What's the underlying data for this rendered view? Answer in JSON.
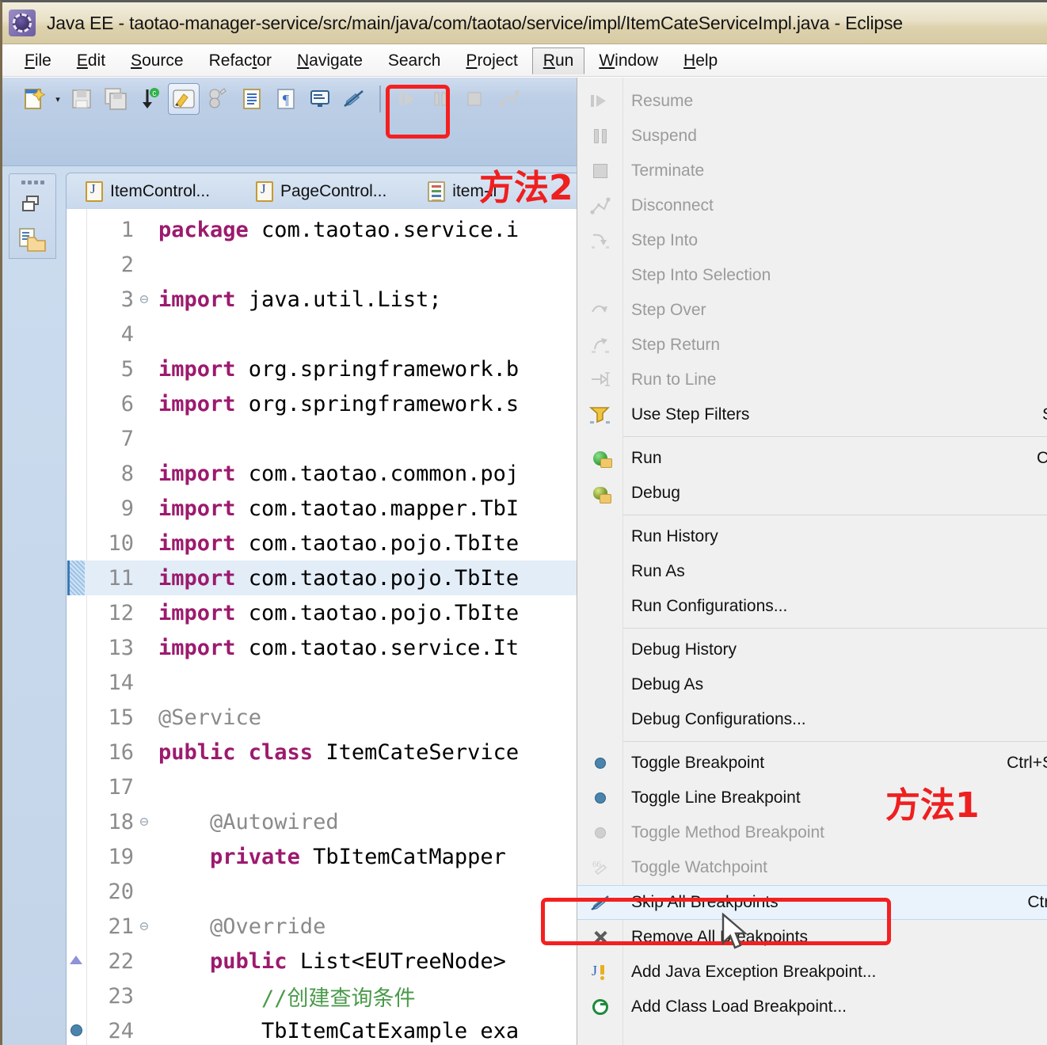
{
  "window": {
    "title": "Java EE - taotao-manager-service/src/main/java/com/taotao/service/impl/ItemCateServiceImpl.java - Eclipse",
    "app_icon": "eclipse-icon"
  },
  "menubar": {
    "items": [
      {
        "label": "File",
        "mnemonic": "F",
        "active": false
      },
      {
        "label": "Edit",
        "mnemonic": "E",
        "active": false
      },
      {
        "label": "Source",
        "mnemonic": "S",
        "active": false
      },
      {
        "label": "Refactor",
        "mnemonic": "t",
        "active": false
      },
      {
        "label": "Navigate",
        "mnemonic": "N",
        "active": false
      },
      {
        "label": "Search",
        "mnemonic": "",
        "active": false
      },
      {
        "label": "Project",
        "mnemonic": "P",
        "active": false
      },
      {
        "label": "Run",
        "mnemonic": "R",
        "active": true
      },
      {
        "label": "Window",
        "mnemonic": "W",
        "active": false
      },
      {
        "label": "Help",
        "mnemonic": "H",
        "active": false
      }
    ]
  },
  "toolbar": {
    "buttons": [
      {
        "name": "new-wizard-icon",
        "pressed": false
      },
      {
        "name": "new-wizard-dropdown-icon",
        "pressed": false
      },
      {
        "name": "save-icon",
        "pressed": false
      },
      {
        "name": "save-all-icon",
        "pressed": false
      },
      {
        "name": "print-icon",
        "pressed": false
      },
      {
        "name": "quick-access-icon",
        "pressed": false
      },
      {
        "name": "toggle-markoccurrences-icon",
        "pressed": true
      },
      {
        "name": "build-icon",
        "pressed": false
      },
      {
        "name": "open-type-icon",
        "pressed": false
      },
      {
        "name": "show-whitespace-icon",
        "pressed": false
      },
      {
        "name": "open-console-icon",
        "pressed": false
      },
      {
        "name": "skip-all-breakpoints-icon",
        "pressed": false
      },
      {
        "name": "resume-icon",
        "pressed": false
      },
      {
        "name": "suspend-icon",
        "pressed": false
      },
      {
        "name": "terminate-icon",
        "pressed": false
      },
      {
        "name": "disconnect-icon",
        "pressed": false
      }
    ]
  },
  "editor": {
    "tabs": [
      {
        "label": "ItemControl...",
        "icon": "java-file-icon",
        "active": false
      },
      {
        "label": "PageControl...",
        "icon": "java-file-icon",
        "active": false
      },
      {
        "label": "item-li",
        "icon": "xml-file-icon",
        "active": false
      }
    ],
    "lines": [
      {
        "num": "1",
        "fold": "",
        "marker": "",
        "highlight": false,
        "segments": [
          {
            "t": "package",
            "c": "kw"
          },
          {
            "t": " com.taotao.service.i",
            "c": ""
          }
        ]
      },
      {
        "num": "2",
        "fold": "",
        "marker": "",
        "highlight": false,
        "segments": []
      },
      {
        "num": "3",
        "fold": "⊖",
        "marker": "",
        "highlight": false,
        "segments": [
          {
            "t": "import",
            "c": "kw"
          },
          {
            "t": " java.util.List;",
            "c": ""
          }
        ]
      },
      {
        "num": "4",
        "fold": "",
        "marker": "",
        "highlight": false,
        "segments": []
      },
      {
        "num": "5",
        "fold": "",
        "marker": "",
        "highlight": false,
        "segments": [
          {
            "t": "import",
            "c": "kw"
          },
          {
            "t": " org.springframework.b",
            "c": ""
          }
        ]
      },
      {
        "num": "6",
        "fold": "",
        "marker": "",
        "highlight": false,
        "segments": [
          {
            "t": "import",
            "c": "kw"
          },
          {
            "t": " org.springframework.s",
            "c": ""
          }
        ]
      },
      {
        "num": "7",
        "fold": "",
        "marker": "",
        "highlight": false,
        "segments": []
      },
      {
        "num": "8",
        "fold": "",
        "marker": "",
        "highlight": false,
        "segments": [
          {
            "t": "import",
            "c": "kw"
          },
          {
            "t": " com.taotao.common.poj",
            "c": ""
          }
        ]
      },
      {
        "num": "9",
        "fold": "",
        "marker": "",
        "highlight": false,
        "segments": [
          {
            "t": "import",
            "c": "kw"
          },
          {
            "t": " com.taotao.mapper.TbI",
            "c": ""
          }
        ]
      },
      {
        "num": "10",
        "fold": "",
        "marker": "",
        "highlight": false,
        "segments": [
          {
            "t": "import",
            "c": "kw"
          },
          {
            "t": " com.taotao.pojo.TbIte",
            "c": ""
          }
        ]
      },
      {
        "num": "11",
        "fold": "",
        "marker": "change",
        "highlight": true,
        "segments": [
          {
            "t": "import",
            "c": "kw"
          },
          {
            "t": " com.taotao.pojo.TbIte",
            "c": ""
          }
        ]
      },
      {
        "num": "12",
        "fold": "",
        "marker": "",
        "highlight": false,
        "segments": [
          {
            "t": "import",
            "c": "kw"
          },
          {
            "t": " com.taotao.pojo.TbIte",
            "c": ""
          }
        ]
      },
      {
        "num": "13",
        "fold": "",
        "marker": "",
        "highlight": false,
        "segments": [
          {
            "t": "import",
            "c": "kw"
          },
          {
            "t": " com.taotao.service.It",
            "c": ""
          }
        ]
      },
      {
        "num": "14",
        "fold": "",
        "marker": "",
        "highlight": false,
        "segments": []
      },
      {
        "num": "15",
        "fold": "",
        "marker": "",
        "highlight": false,
        "segments": [
          {
            "t": "@Service",
            "c": "ann"
          }
        ]
      },
      {
        "num": "16",
        "fold": "",
        "marker": "",
        "highlight": false,
        "segments": [
          {
            "t": "public class",
            "c": "kw"
          },
          {
            "t": " ItemCateService",
            "c": ""
          }
        ]
      },
      {
        "num": "17",
        "fold": "",
        "marker": "",
        "highlight": false,
        "segments": []
      },
      {
        "num": "18",
        "fold": "⊖",
        "marker": "",
        "highlight": false,
        "segments": [
          {
            "t": "    @Autowired",
            "c": "ann"
          }
        ]
      },
      {
        "num": "19",
        "fold": "",
        "marker": "",
        "highlight": false,
        "segments": [
          {
            "t": "    private",
            "c": "kw"
          },
          {
            "t": " TbItemCatMapper ",
            "c": ""
          }
        ]
      },
      {
        "num": "20",
        "fold": "",
        "marker": "",
        "highlight": false,
        "segments": []
      },
      {
        "num": "21",
        "fold": "⊖",
        "marker": "",
        "highlight": false,
        "segments": [
          {
            "t": "    @Override",
            "c": "ann"
          }
        ]
      },
      {
        "num": "22",
        "fold": "",
        "marker": "override",
        "highlight": false,
        "segments": [
          {
            "t": "    public",
            "c": "kw"
          },
          {
            "t": " List<EUTreeNode> ",
            "c": ""
          }
        ]
      },
      {
        "num": "23",
        "fold": "",
        "marker": "",
        "highlight": false,
        "segments": [
          {
            "t": "        //创建查询条件",
            "c": "cmt"
          }
        ]
      },
      {
        "num": "24",
        "fold": "",
        "marker": "breakpoint",
        "highlight": false,
        "segments": [
          {
            "t": "        TbItemCatExample exa",
            "c": ""
          }
        ]
      }
    ]
  },
  "run_menu": {
    "groups": [
      {
        "items": [
          {
            "label": "Resume",
            "icon": "resume-icon",
            "shortcut": "",
            "disabled": true,
            "hovered": false
          },
          {
            "label": "Suspend",
            "icon": "suspend-icon",
            "shortcut": "",
            "disabled": true,
            "hovered": false
          },
          {
            "label": "Terminate",
            "icon": "terminate-icon",
            "shortcut": "",
            "disabled": true,
            "hovered": false
          },
          {
            "label": "Disconnect",
            "icon": "disconnect-icon",
            "shortcut": "",
            "disabled": true,
            "hovered": false
          },
          {
            "label": "Step Into",
            "icon": "step-into-icon",
            "shortcut": "",
            "disabled": true,
            "hovered": false
          },
          {
            "label": "Step Into Selection",
            "icon": "",
            "shortcut": "",
            "disabled": true,
            "hovered": false
          },
          {
            "label": "Step Over",
            "icon": "step-over-icon",
            "shortcut": "",
            "disabled": true,
            "hovered": false
          },
          {
            "label": "Step Return",
            "icon": "step-return-icon",
            "shortcut": "",
            "disabled": true,
            "hovered": false
          },
          {
            "label": "Run to Line",
            "icon": "run-to-line-icon",
            "shortcut": "",
            "disabled": true,
            "hovered": false
          },
          {
            "label": "Use Step Filters",
            "icon": "step-filters-icon",
            "shortcut": "S",
            "disabled": false,
            "hovered": false
          }
        ]
      },
      {
        "items": [
          {
            "label": "Run",
            "icon": "run-icon",
            "shortcut": "Ct",
            "disabled": false,
            "hovered": false
          },
          {
            "label": "Debug",
            "icon": "debug-icon",
            "shortcut": "",
            "disabled": false,
            "hovered": false
          }
        ]
      },
      {
        "items": [
          {
            "label": "Run History",
            "icon": "",
            "shortcut": "",
            "disabled": false,
            "hovered": false
          },
          {
            "label": "Run As",
            "icon": "",
            "shortcut": "",
            "disabled": false,
            "hovered": false
          },
          {
            "label": "Run Configurations...",
            "icon": "",
            "shortcut": "",
            "disabled": false,
            "hovered": false
          }
        ]
      },
      {
        "items": [
          {
            "label": "Debug History",
            "icon": "",
            "shortcut": "",
            "disabled": false,
            "hovered": false
          },
          {
            "label": "Debug As",
            "icon": "",
            "shortcut": "",
            "disabled": false,
            "hovered": false
          },
          {
            "label": "Debug Configurations...",
            "icon": "",
            "shortcut": "",
            "disabled": false,
            "hovered": false
          }
        ]
      },
      {
        "items": [
          {
            "label": "Toggle Breakpoint",
            "icon": "breakpoint-on-icon",
            "shortcut": "Ctrl+S",
            "disabled": false,
            "hovered": false
          },
          {
            "label": "Toggle Line Breakpoint",
            "icon": "breakpoint-on-icon",
            "shortcut": "",
            "disabled": false,
            "hovered": false
          },
          {
            "label": "Toggle Method Breakpoint",
            "icon": "breakpoint-off-icon",
            "shortcut": "",
            "disabled": true,
            "hovered": false
          },
          {
            "label": "Toggle Watchpoint",
            "icon": "watchpoint-icon",
            "shortcut": "",
            "disabled": true,
            "hovered": false
          },
          {
            "label": "Skip All Breakpoints",
            "icon": "skip-all-breakpoints-icon",
            "shortcut": "Ctrl",
            "disabled": false,
            "hovered": true
          },
          {
            "label": "Remove All Breakpoints",
            "icon": "remove-all-breakpoints-icon",
            "shortcut": "",
            "disabled": false,
            "hovered": false
          },
          {
            "label": "Add Java Exception Breakpoint...",
            "icon": "java-exception-breakpoint-icon",
            "shortcut": "",
            "disabled": false,
            "hovered": false
          },
          {
            "label": "Add Class Load Breakpoint...",
            "icon": "class-load-breakpoint-icon",
            "shortcut": "",
            "disabled": false,
            "hovered": false
          }
        ]
      }
    ]
  },
  "annotations": [
    {
      "name": "method-2-label",
      "text": "方法2",
      "color": "#ef1f1f"
    },
    {
      "name": "method-1-label",
      "text": "方法1",
      "color": "#ef1f1f"
    }
  ],
  "colors": {
    "annotation_red": "#ef1f1f",
    "highlight_blue": "#e2edf8",
    "toolbar_blue": "#b6cae3",
    "menu_bg": "#f0f0f0",
    "keyword_purple": "#9c1a6e",
    "comment_green": "#4a9a4a"
  }
}
